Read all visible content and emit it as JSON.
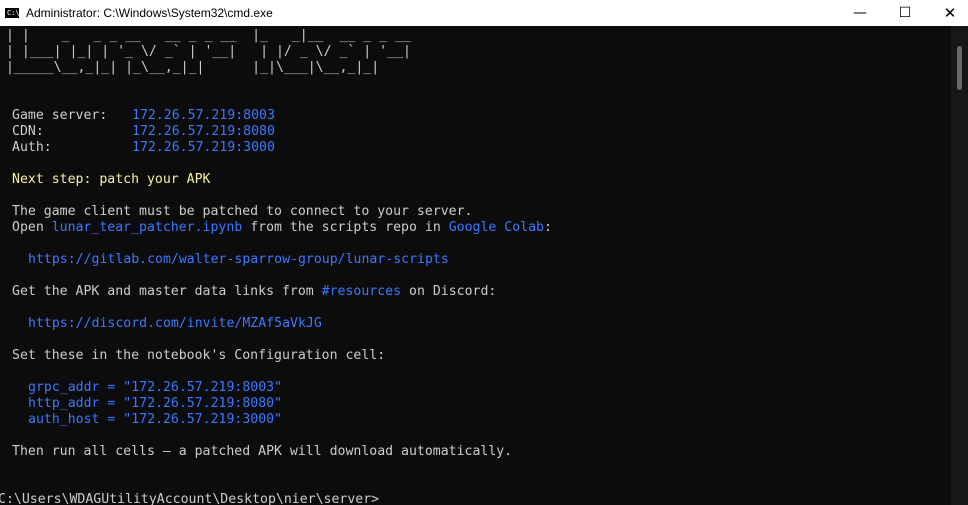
{
  "window": {
    "title": "Administrator: C:\\Windows\\System32\\cmd.exe",
    "minimize": "—",
    "maximize": "☐",
    "close": "✕",
    "icon": "cmd-icon"
  },
  "banner": [
    "| |    _   _ _ __   __ _ _ __  |_   _|__  __ _ _ __ ",
    "| |___| |_| | '_ \\/ _` | '__|   | |/ _ \\/ _` | '__|",
    "|_____\\__,_|_| |_\\__,_|_|      |_|\\___|\\__,_|_|   "
  ],
  "servers": [
    {
      "label": "Game server:",
      "value": "172.26.57.219:8003"
    },
    {
      "label": "CDN:",
      "value": "172.26.57.219:8080"
    },
    {
      "label": "Auth:",
      "value": "172.26.57.219:3000"
    }
  ],
  "next_step": "Next step: patch your APK",
  "patch_line1": "The game client must be patched to connect to your server.",
  "patch_line2": {
    "open": "Open ",
    "file": "lunar_tear_patcher.ipynb",
    "mid": " from the scripts repo in ",
    "colab": "Google Colab",
    "end": ":"
  },
  "repo_url": "https://gitlab.com/walter-sparrow-group/lunar-scripts",
  "apk_line": {
    "start": "Get the APK and master data links from ",
    "channel": "#resources",
    "end": " on Discord:"
  },
  "discord_url": "https://discord.com/invite/MZAf5aVkJG",
  "config_line": "Set these in the notebook's Configuration cell:",
  "config": [
    "grpc_addr = \"172.26.57.219:8003\"",
    "http_addr = \"172.26.57.219:8080\"",
    "auth_host = \"172.26.57.219:3000\""
  ],
  "final_line": "Then run all cells — a patched APK will download automatically.",
  "prompt": "C:\\Users\\WDAGUtilityAccount\\Desktop\\nier\\server>",
  "cursor": "_"
}
